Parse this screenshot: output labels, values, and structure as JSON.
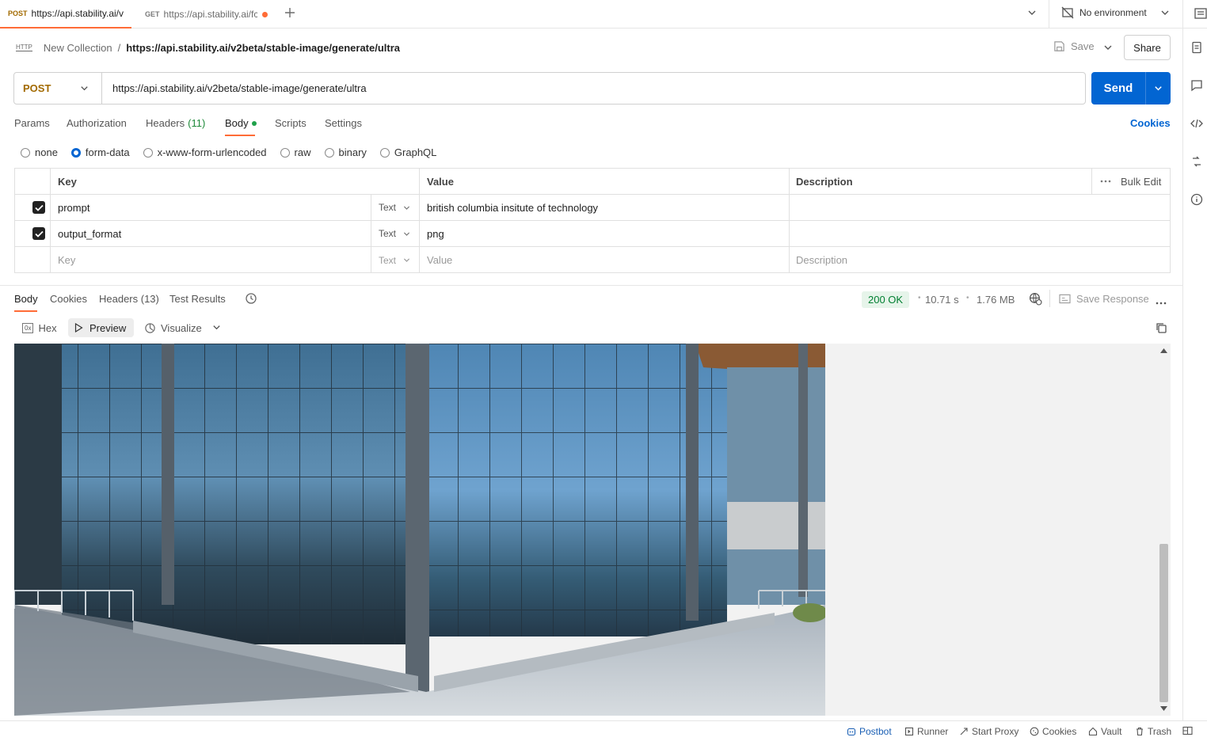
{
  "tabs": [
    {
      "method": "POST",
      "label": "https://api.stability.ai/v",
      "active": true
    },
    {
      "method": "GET",
      "label": "https://api.stability.ai/fc",
      "unsaved": true
    }
  ],
  "environment": "No environment",
  "breadcrumb": {
    "icon_text": "HTTP",
    "collection": "New Collection",
    "separator": "/",
    "request": "https://api.stability.ai/v2beta/stable-image/generate/ultra"
  },
  "header_actions": {
    "save": "Save",
    "share": "Share"
  },
  "request": {
    "method": "POST",
    "url": "https://api.stability.ai/v2beta/stable-image/generate/ultra",
    "send": "Send"
  },
  "request_tabs": {
    "params": "Params",
    "authorization": "Authorization",
    "headers": "Headers",
    "headers_count": "(11)",
    "body": "Body",
    "scripts": "Scripts",
    "settings": "Settings",
    "cookies": "Cookies"
  },
  "body_types": [
    "none",
    "form-data",
    "x-www-form-urlencoded",
    "raw",
    "binary",
    "GraphQL"
  ],
  "body_type_selected": "form-data",
  "table": {
    "headers": {
      "key": "Key",
      "value": "Value",
      "description": "Description",
      "bulk_edit": "Bulk Edit"
    },
    "rows": [
      {
        "checked": true,
        "key": "prompt",
        "type": "Text",
        "value": "british columbia insitute of technology",
        "description": ""
      },
      {
        "checked": true,
        "key": "output_format",
        "type": "Text",
        "value": "png",
        "description": ""
      }
    ],
    "placeholder": {
      "key": "Key",
      "type": "Text",
      "value": "Value",
      "description": "Description"
    }
  },
  "response_tabs": {
    "body": "Body",
    "cookies": "Cookies",
    "headers": "Headers (13)",
    "tests": "Test Results"
  },
  "response_meta": {
    "status": "200 OK",
    "time": "10.71 s",
    "size": "1.76 MB",
    "save_response": "Save Response"
  },
  "view_modes": {
    "hex": "Hex",
    "hex_icon": "0x",
    "preview": "Preview",
    "visualize": "Visualize"
  },
  "footer": {
    "postbot": "Postbot",
    "runner": "Runner",
    "start_proxy": "Start Proxy",
    "cookies": "Cookies",
    "vault": "Vault",
    "trash": "Trash"
  },
  "colors": {
    "accent": "#ff6c37",
    "send": "#0265d2",
    "post": "#a26a00",
    "status_ok": "#007f31"
  }
}
